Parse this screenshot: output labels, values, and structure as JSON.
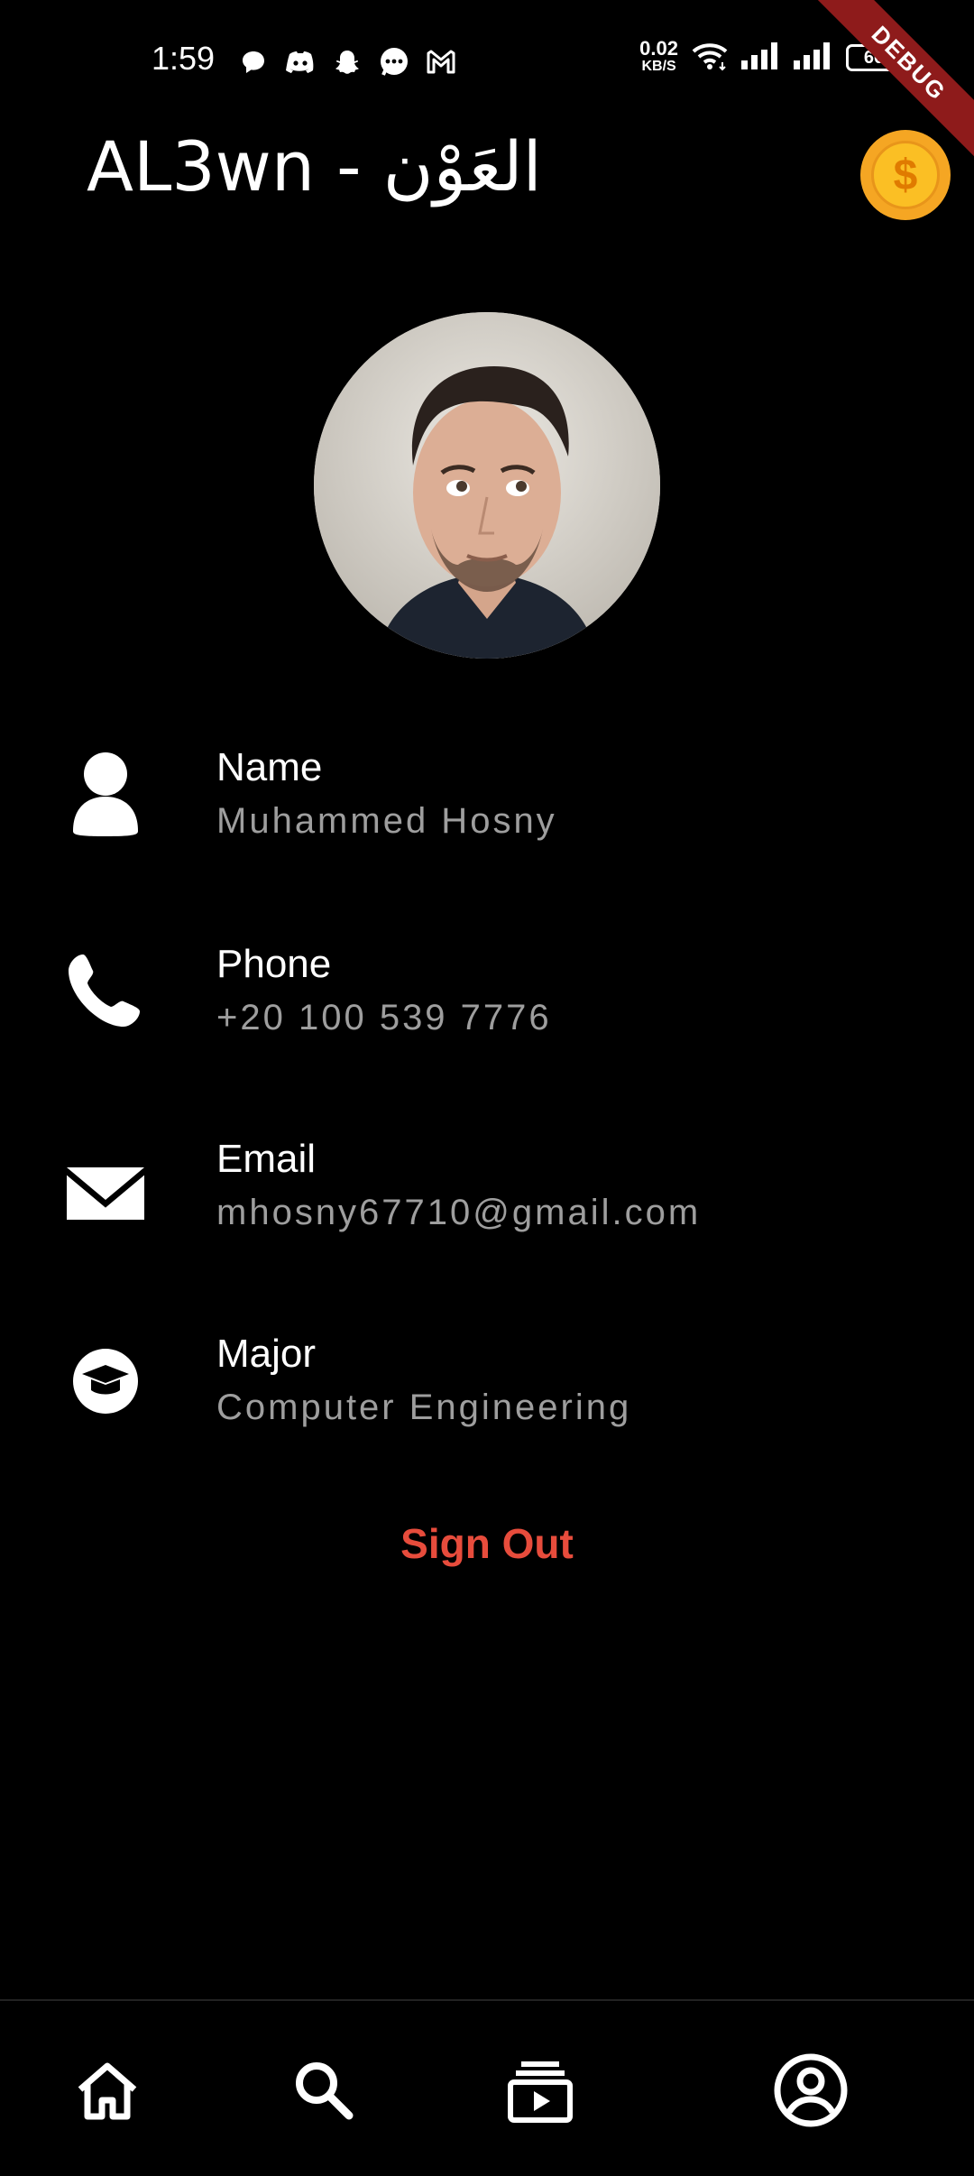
{
  "status_bar": {
    "time": "1:59",
    "net_speed": "0.02",
    "net_unit": "KB/S",
    "battery": "66",
    "notification_icons": [
      "chat-bubble-icon",
      "discord-icon",
      "snapchat-icon",
      "messenger-icon",
      "gmail-icon"
    ]
  },
  "debug_banner": "DEBUG",
  "app_bar": {
    "title": "AL3wn - العَوْن",
    "coin_symbol": "$"
  },
  "profile": {
    "rows": [
      {
        "label": "Name",
        "value": "Muhammed Hosny",
        "icon": "person-icon"
      },
      {
        "label": "Phone",
        "value": "+20 100 539 7776",
        "icon": "phone-icon"
      },
      {
        "label": "Email",
        "value": "mhosny67710@gmail.com",
        "icon": "mail-icon"
      },
      {
        "label": "Major",
        "value": "Computer Engineering",
        "icon": "graduation-cap-icon"
      }
    ],
    "sign_out": "Sign Out"
  },
  "colors": {
    "background": "#000000",
    "sign_out": "#e74c3c",
    "secondary_text": "#9e9e9e",
    "coin": "#f5a623"
  },
  "bottom_nav": {
    "items": [
      "home-icon",
      "search-icon",
      "video-library-icon",
      "account-circle-icon"
    ]
  }
}
